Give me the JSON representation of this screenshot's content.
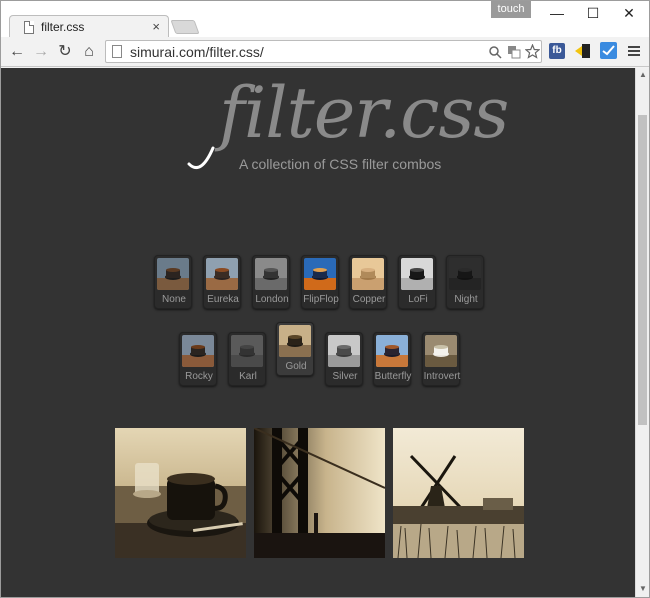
{
  "browser": {
    "tab_title": "filter.css",
    "tab_close": "×",
    "touch_label": "touch",
    "url": "simurai.com/filter.css/",
    "ext_fb": "fb",
    "window_controls": {
      "minimize": "—",
      "maximize": "☐",
      "close": "✕"
    },
    "nav": {
      "back": "←",
      "forward": "→",
      "reload": "↻",
      "home": "⌂"
    }
  },
  "page": {
    "logo": "filter.css",
    "tagline": "A collection of CSS filter combos",
    "filters_row1": [
      "None",
      "Eureka",
      "London",
      "FlipFlop",
      "Copper",
      "LoFi",
      "Night"
    ],
    "filters_row2": [
      "Rocky",
      "Karl",
      "Gold",
      "Silver",
      "Butterfly",
      "Introvert"
    ],
    "active_filter": "Gold",
    "photos": [
      "coffee cup",
      "bridge",
      "windmill"
    ]
  },
  "colors": {
    "page_bg": "#333333",
    "sepia_light": "#e9dcc0",
    "sepia_dark": "#1e1a14"
  }
}
